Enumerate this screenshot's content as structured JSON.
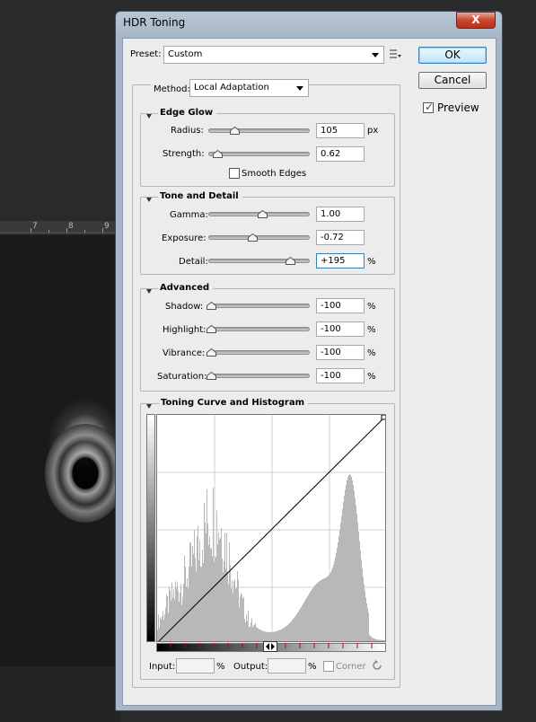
{
  "background": {
    "ruler_ticks": [
      "7",
      "8",
      "9"
    ]
  },
  "window": {
    "title": "HDR Toning",
    "close_label": "X"
  },
  "preset": {
    "label": "Preset:",
    "value": "Custom"
  },
  "method": {
    "label": "Method:",
    "value": "Local Adaptation"
  },
  "buttons": {
    "ok": "OK",
    "cancel": "Cancel",
    "preview_label": "Preview",
    "preview_checked": true
  },
  "edge_glow": {
    "title": "Edge Glow",
    "radius_label": "Radius:",
    "radius_value": "105",
    "radius_unit": "px",
    "radius_slider": 0.25,
    "strength_label": "Strength:",
    "strength_value": "0.62",
    "strength_slider": 0.07,
    "smooth_edges_label": "Smooth Edges",
    "smooth_edges_checked": false
  },
  "tone_detail": {
    "title": "Tone and Detail",
    "gamma_label": "Gamma:",
    "gamma_value": "1.00",
    "gamma_slider": 0.55,
    "exposure_label": "Exposure:",
    "exposure_value": "-0.72",
    "exposure_slider": 0.45,
    "detail_label": "Detail:",
    "detail_value": "+195",
    "detail_unit": "%",
    "detail_slider": 0.85
  },
  "advanced": {
    "title": "Advanced",
    "shadow_label": "Shadow:",
    "shadow_value": "-100",
    "highlight_label": "Highlight:",
    "highlight_value": "-100",
    "vibrance_label": "Vibrance:",
    "vibrance_value": "-100",
    "saturation_label": "Saturation:",
    "saturation_value": "-100",
    "unit": "%"
  },
  "curve": {
    "title": "Toning Curve and Histogram",
    "input_label": "Input:",
    "input_value": "",
    "output_label": "Output:",
    "output_value": "",
    "pct": "%",
    "corner_label": "Corner",
    "corner_checked": false
  },
  "colors": {
    "dialog_bg": "#ececec",
    "histogram": "#b8b8b8",
    "marker_red": "#c00000"
  }
}
